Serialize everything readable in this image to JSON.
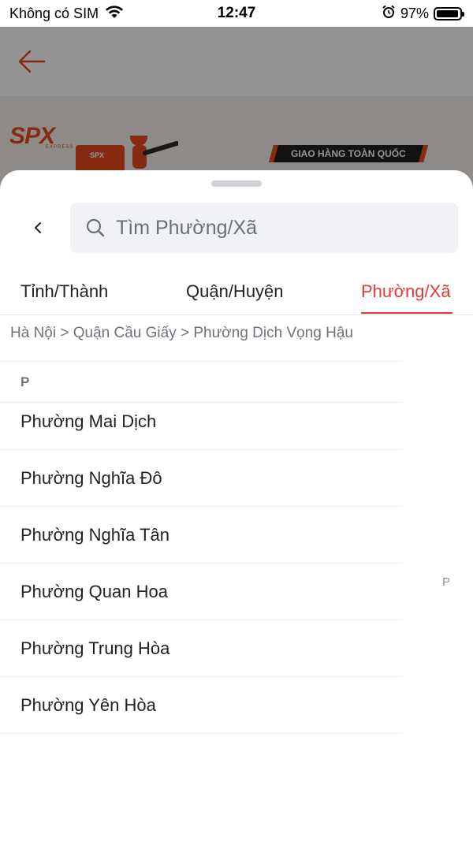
{
  "status_bar": {
    "carrier": "Không có SIM",
    "time": "12:47",
    "battery_percent": "97%",
    "battery_level": 0.97
  },
  "banner": {
    "logo_text": "SPX",
    "logo_sub": "EXPRESS",
    "box_text": "SPX",
    "tagline": "GIAO HÀNG TOÀN QUỐC"
  },
  "search": {
    "placeholder": "Tìm Phường/Xã"
  },
  "tabs": [
    {
      "label": "Tỉnh/Thành"
    },
    {
      "label": "Quận/Huyện"
    },
    {
      "label": "Phường/Xã"
    }
  ],
  "breadcrumb": "Hà Nội > Quận Cầu Giấy > Phường Dịch Vọng Hậu",
  "list": {
    "section_letter": "P",
    "items": [
      {
        "label": "Phường Mai Dịch"
      },
      {
        "label": "Phường Nghĩa Đô"
      },
      {
        "label": "Phường Nghĩa Tân"
      },
      {
        "label": "Phường Quan Hoa"
      },
      {
        "label": "Phường Trung Hòa"
      },
      {
        "label": "Phường Yên Hòa"
      }
    ]
  },
  "index_bar": [
    "P"
  ],
  "colors": {
    "accent": "#e53935",
    "brand": "#e8491f"
  }
}
